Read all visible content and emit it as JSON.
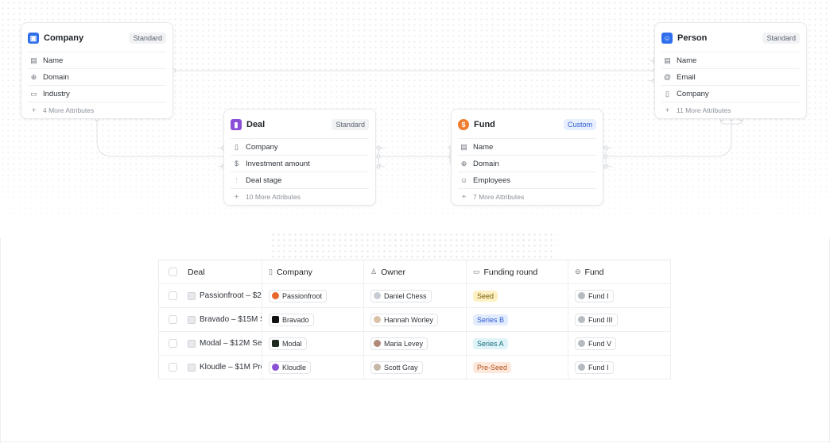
{
  "cards": {
    "company": {
      "title": "Company",
      "badge": "Standard",
      "icon": "building-icon",
      "color": "#2f6fed",
      "attrs": [
        {
          "label": "Name",
          "icon": "text-field-icon"
        },
        {
          "label": "Domain",
          "icon": "globe-icon"
        },
        {
          "label": "Industry",
          "icon": "tag-icon"
        }
      ],
      "more": "4 More Attributes"
    },
    "person": {
      "title": "Person",
      "badge": "Standard",
      "icon": "people-icon",
      "color": "#2f6fed",
      "attrs": [
        {
          "label": "Name",
          "icon": "id-card-icon"
        },
        {
          "label": "Email",
          "icon": "at-icon"
        },
        {
          "label": "Company",
          "icon": "building-icon"
        }
      ],
      "more": "11 More Attributes"
    },
    "deal": {
      "title": "Deal",
      "badge": "Standard",
      "icon": "deal-icon",
      "color": "#8a4fd6",
      "attrs": [
        {
          "label": "Company",
          "icon": "building-icon"
        },
        {
          "label": "Investment amount",
          "icon": "dollar-icon"
        },
        {
          "label": "Deal stage",
          "icon": "stages-icon"
        }
      ],
      "more": "10 More Attributes"
    },
    "fund": {
      "title": "Fund",
      "badge": "Custom",
      "icon": "coin-icon",
      "color": "#f07d2e",
      "attrs": [
        {
          "label": "Name",
          "icon": "id-card-icon"
        },
        {
          "label": "Domain",
          "icon": "globe-icon"
        },
        {
          "label": "Employees",
          "icon": "people-icon"
        }
      ],
      "more": "7 More Attributes"
    }
  },
  "table": {
    "headers": [
      "Deal",
      "Company",
      "Owner",
      "Funding round",
      "Fund"
    ],
    "rows": [
      {
        "deal": "Passionfroot – $2",
        "company": "Passionfroot",
        "company_color": "#e8672c",
        "owner": "Daniel Chess",
        "round": "Seed",
        "round_bg": "#fdf1c4",
        "round_fg": "#7a5a00",
        "fund": "Fund I"
      },
      {
        "deal": "Bravado – $15M S",
        "company": "Bravado",
        "company_color": "#111111",
        "owner": "Hannah Worley",
        "round": "Series B",
        "round_bg": "#e3ecfd",
        "round_fg": "#2d5bd0",
        "fund": "Fund III"
      },
      {
        "deal": "Modal – $12M Se",
        "company": "Modal",
        "company_color": "#1e2a1e",
        "owner": "Maria Levey",
        "round": "Series A",
        "round_bg": "#dff4f8",
        "round_fg": "#176b7d",
        "fund": "Fund V"
      },
      {
        "deal": "Kloudle – $1M Pre",
        "company": "Kloudle",
        "company_color": "#8a4fd6",
        "owner": "Scott Gray",
        "round": "Pre-Seed",
        "round_bg": "#fde9dc",
        "round_fg": "#b2501c",
        "fund": "Fund I"
      }
    ]
  }
}
